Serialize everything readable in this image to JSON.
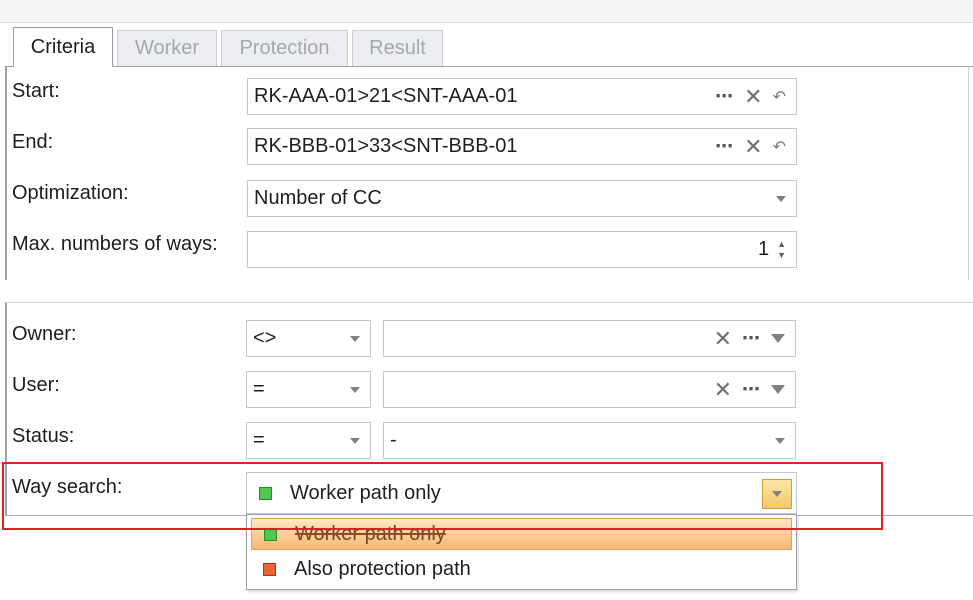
{
  "tabs": [
    {
      "label": "Criteria",
      "active": true
    },
    {
      "label": "Worker",
      "active": false
    },
    {
      "label": "Protection",
      "active": false
    },
    {
      "label": "Result",
      "active": false
    }
  ],
  "criteria": {
    "start": {
      "label": "Start:",
      "value": "RK-AAA-01>21<SNT-AAA-01"
    },
    "end": {
      "label": "End:",
      "value": "RK-BBB-01>33<SNT-BBB-01"
    },
    "optimization": {
      "label": "Optimization:",
      "value": "Number of CC"
    },
    "max_ways": {
      "label": "Max. numbers of ways:",
      "value": "1"
    }
  },
  "filters": {
    "owner": {
      "label": "Owner:",
      "operator": "<>",
      "value": ""
    },
    "user": {
      "label": "User:",
      "operator": "=",
      "value": ""
    },
    "status": {
      "label": "Status:",
      "operator": "=",
      "value": "-"
    },
    "way_search": {
      "label": "Way search:",
      "value": "Worker path only"
    }
  },
  "way_search_options": [
    {
      "label": "Worker path only",
      "color": "#4ec94e",
      "selected": true
    },
    {
      "label": "Also protection path",
      "color": "#f0622d",
      "selected": false
    }
  ],
  "glyphs": {
    "dots": "⋯",
    "clear": "✕",
    "undo": "↶",
    "spin_up": "▲",
    "spin_down": "▼"
  },
  "colors": {
    "highlight": "#e12024",
    "dropdown_selected": "#f8b771"
  }
}
